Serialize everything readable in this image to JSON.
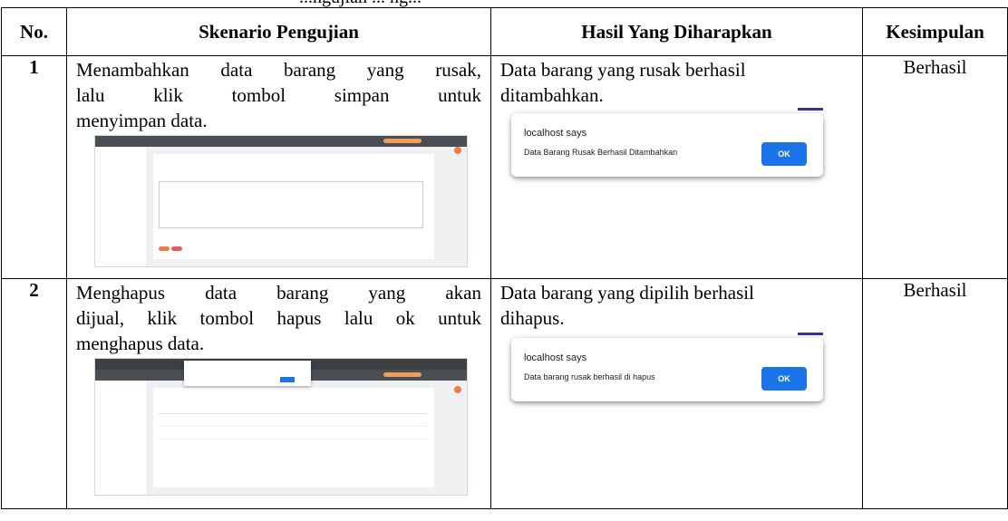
{
  "caption_partial": "...ngujian ... ng...",
  "headers": {
    "no": "No.",
    "skenario": "Skenario Pengujian",
    "hasil": "Hasil Yang Diharapkan",
    "kesimpulan": "Kesimpulan"
  },
  "rows": [
    {
      "no": "1",
      "skenario_line1": "Menambahkan data barang yang rusak,",
      "skenario_line2": "lalu klik tombol simpan untuk",
      "skenario_line3": "menyimpan data.",
      "hasil_line1": "Data barang yang rusak berhasil",
      "hasil_line2": "ditambahkan.",
      "dialog_title": "localhost says",
      "dialog_message": "Data Barang Rusak Berhasil Ditambahkan",
      "dialog_ok": "OK",
      "kesimpulan": "Berhasil"
    },
    {
      "no": "2",
      "skenario_line1": "Menghapus data barang yang akan",
      "skenario_line2": "dijual, klik tombol hapus lalu ok untuk",
      "skenario_line3": "menghapus data.",
      "hasil_line1": "Data barang yang dipilih berhasil",
      "hasil_line2": "dihapus.",
      "dialog_title": "localhost says",
      "dialog_message": "Data barang rusak berhasil di hapus",
      "dialog_ok": "OK",
      "kesimpulan": "Berhasil"
    }
  ],
  "colors": {
    "dialog_button": "#1a73e8",
    "accent_orange": "#ef7b45",
    "navbar": "#4a4f55"
  }
}
